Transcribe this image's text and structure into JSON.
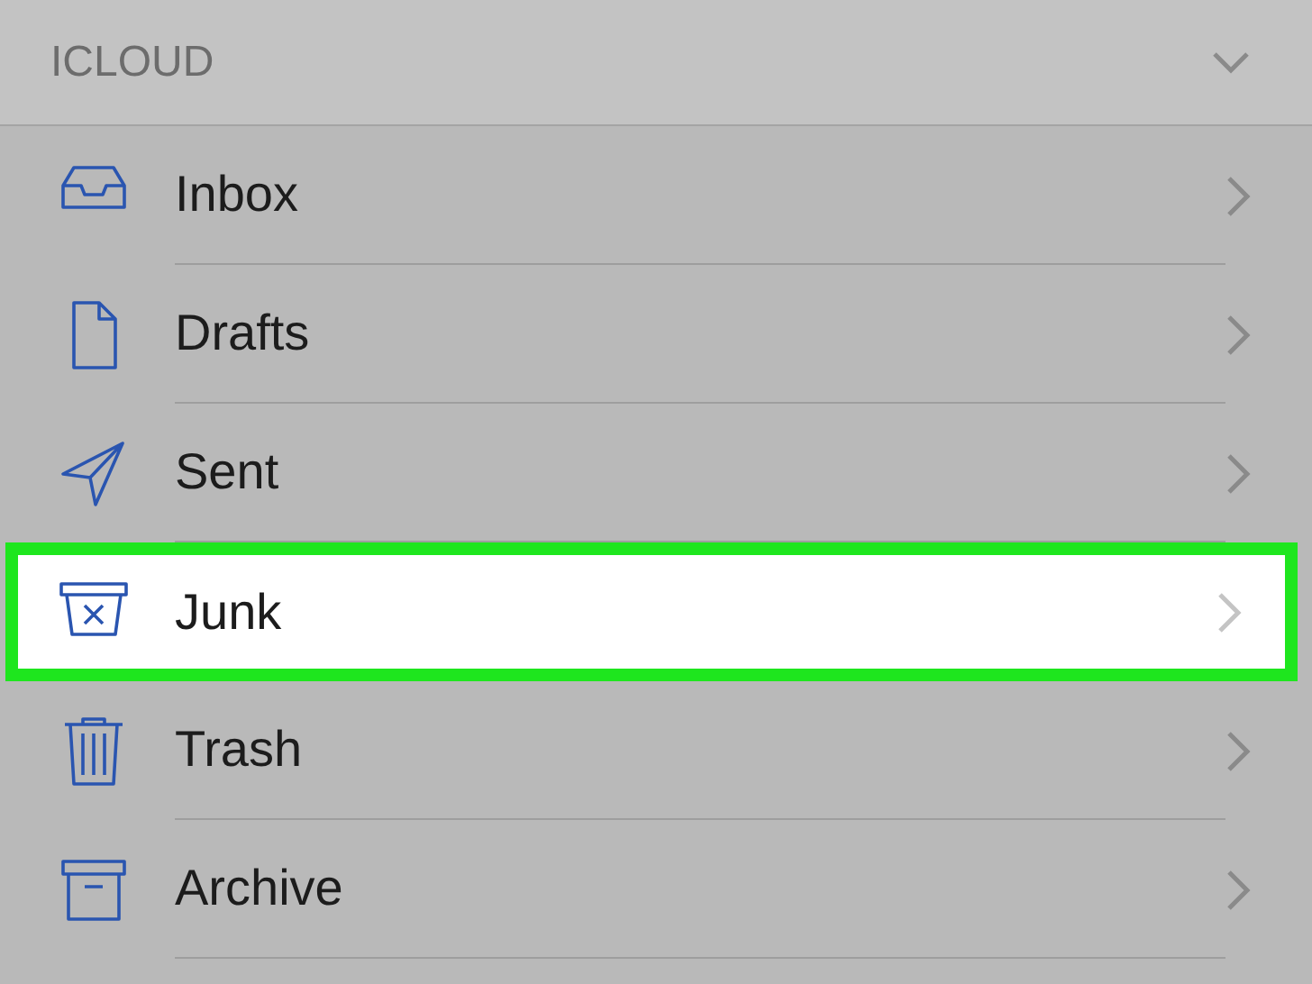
{
  "section": {
    "title": "ICLOUD",
    "expanded": true
  },
  "folders": [
    {
      "kind": "inbox",
      "label": "Inbox",
      "selected": false
    },
    {
      "kind": "drafts",
      "label": "Drafts",
      "selected": false
    },
    {
      "kind": "sent",
      "label": "Sent",
      "selected": false
    },
    {
      "kind": "junk",
      "label": "Junk",
      "selected": true
    },
    {
      "kind": "trash",
      "label": "Trash",
      "selected": false
    },
    {
      "kind": "archive",
      "label": "Archive",
      "selected": false
    }
  ]
}
